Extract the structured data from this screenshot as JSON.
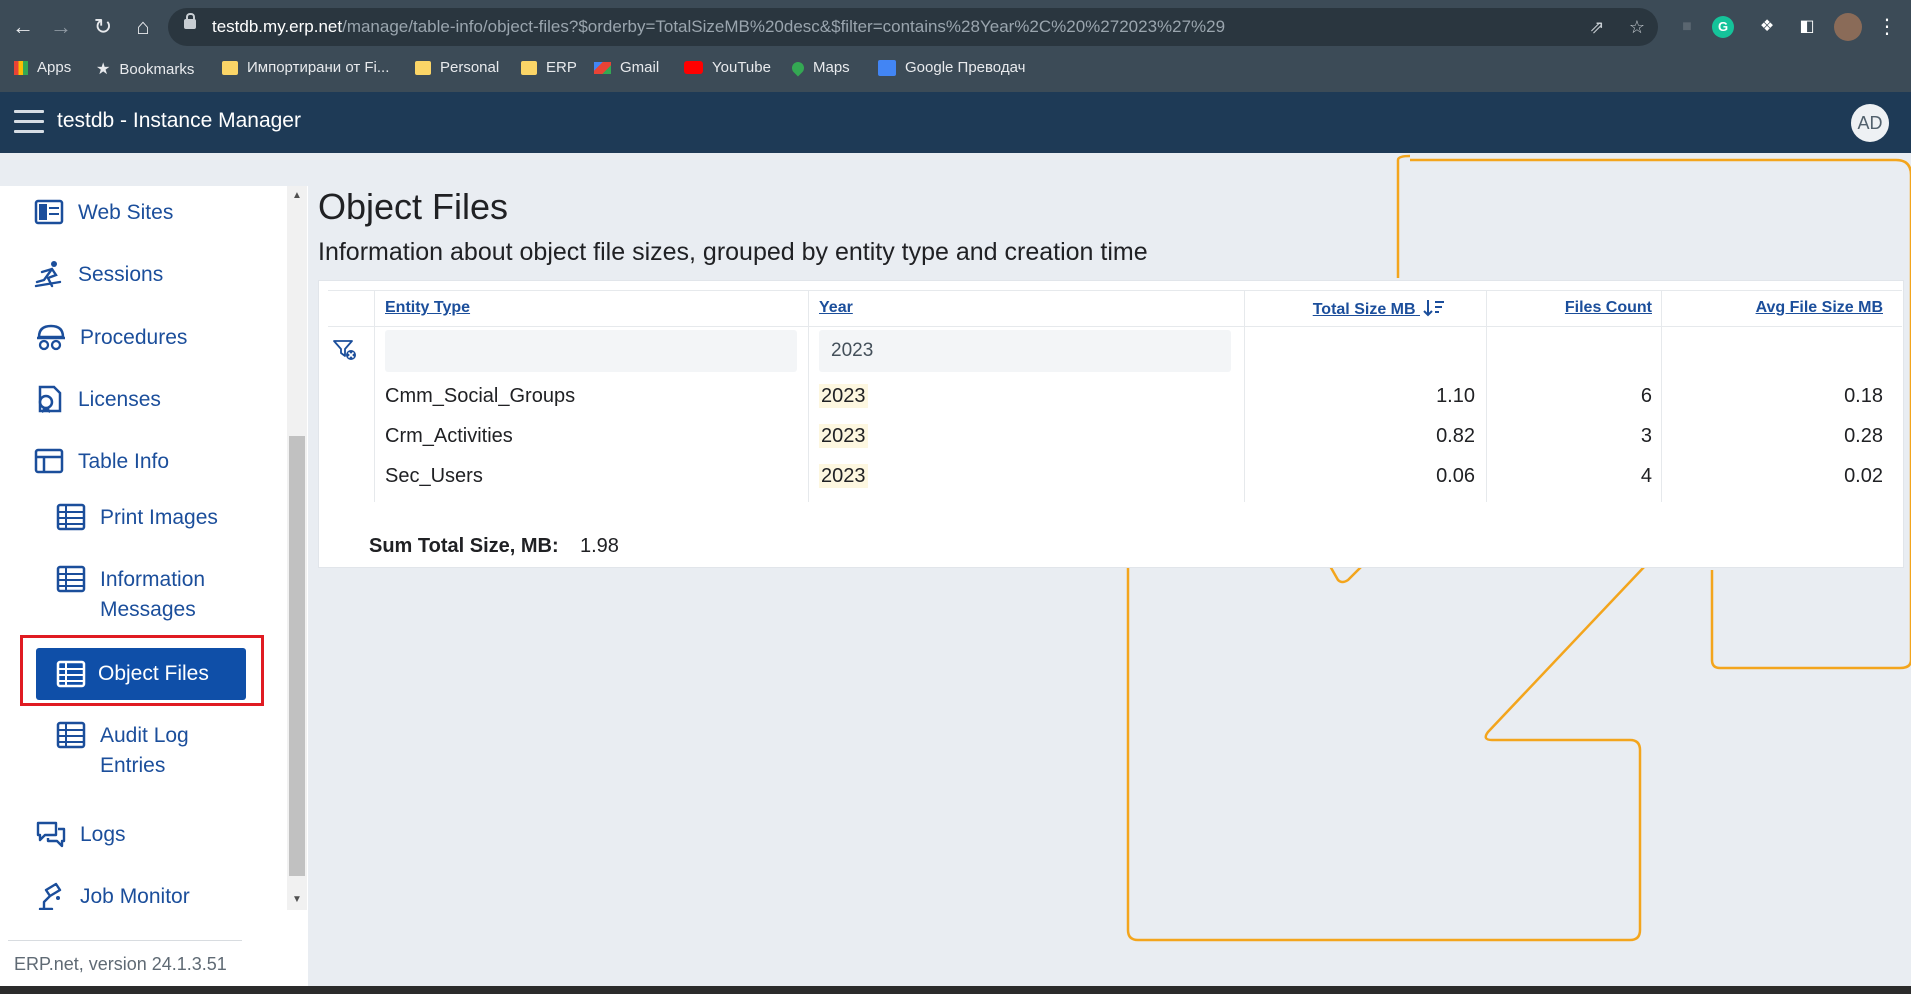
{
  "browser": {
    "url_host": "testdb.my.erp.net",
    "url_path": "/manage/table-info/object-files?$orderby=TotalSizeMB%20desc&$filter=contains%28Year%2C%20%272023%27%29",
    "bookmarks": [
      "Apps",
      "Bookmarks",
      "Импортирани от Fi...",
      "Personal",
      "ERP",
      "Gmail",
      "YouTube",
      "Maps",
      "Google Преводач"
    ]
  },
  "app": {
    "title": "testdb - Instance Manager",
    "avatar": "AD",
    "accent": "#0f4fa8",
    "header_color": "#1e3a56"
  },
  "sidebar": {
    "items": [
      {
        "label": "Web Sites",
        "icon": "web-sites-icon"
      },
      {
        "label": "Sessions",
        "icon": "sessions-icon"
      },
      {
        "label": "Procedures",
        "icon": "procedures-icon"
      },
      {
        "label": "Licenses",
        "icon": "licenses-icon"
      },
      {
        "label": "Table Info",
        "icon": "table-info-icon"
      },
      {
        "label": "Print Images",
        "icon": "table-icon"
      },
      {
        "label_line1": "Information",
        "label_line2": "Messages",
        "icon": "table-icon"
      },
      {
        "label": "Object Files",
        "icon": "table-icon",
        "selected": true
      },
      {
        "label_line1": "Audit Log",
        "label_line2": "Entries",
        "icon": "table-icon"
      },
      {
        "label": "Logs",
        "icon": "logs-icon"
      },
      {
        "label": "Job Monitor",
        "icon": "job-monitor-icon"
      }
    ],
    "version": "ERP.net, version 24.1.3.51"
  },
  "main": {
    "title": "Object Files",
    "subtitle": "Information about object file sizes, grouped by entity type and creation time",
    "table": {
      "columns": [
        "Entity Type",
        "Year",
        "Total Size MB",
        "Files Count",
        "Avg File Size MB"
      ],
      "filter": {
        "entity_type": "",
        "year": "2023"
      },
      "rows": [
        {
          "entity_type": "Cmm_Social_Groups",
          "year": "2023",
          "total_size": "1.10",
          "files_count": "6",
          "avg_size": "0.18"
        },
        {
          "entity_type": "Crm_Activities",
          "year": "2023",
          "total_size": "0.82",
          "files_count": "3",
          "avg_size": "0.28"
        },
        {
          "entity_type": "Sec_Users",
          "year": "2023",
          "total_size": "0.06",
          "files_count": "4",
          "avg_size": "0.02"
        }
      ]
    },
    "sum_label": "Sum Total Size, MB:",
    "sum_value": "1.98"
  }
}
